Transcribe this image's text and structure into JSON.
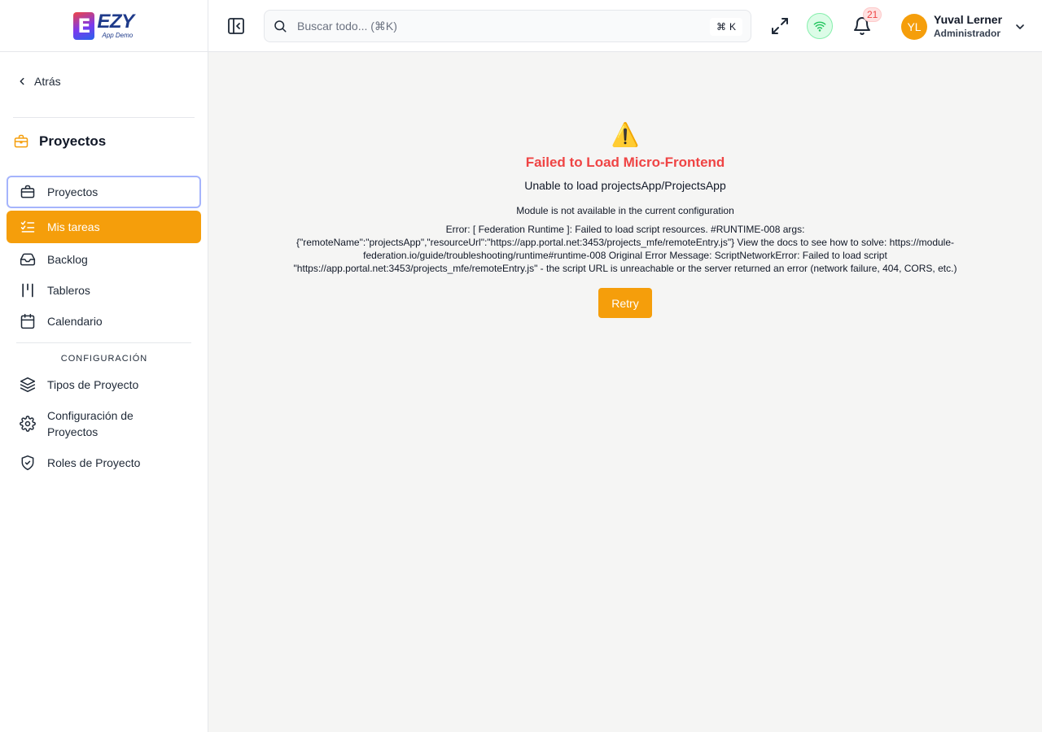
{
  "brand": {
    "logo_letter": "E",
    "name": "EZY",
    "tagline": "App Demo"
  },
  "sidebar": {
    "back_label": "Atrás",
    "section_title": "Proyectos",
    "items": [
      {
        "label": "Proyectos",
        "icon": "briefcase-icon",
        "state": "focused"
      },
      {
        "label": "Mis tareas",
        "icon": "task-list-icon",
        "state": "active"
      },
      {
        "label": "Backlog",
        "icon": "inbox-icon",
        "state": "normal"
      },
      {
        "label": "Tableros",
        "icon": "columns-icon",
        "state": "normal"
      },
      {
        "label": "Calendario",
        "icon": "calendar-icon",
        "state": "normal"
      }
    ],
    "config_label": "CONFIGURACIÓN",
    "config_items": [
      {
        "label": "Tipos de Proyecto",
        "icon": "layers-icon"
      },
      {
        "label": "Configuración de Proyectos",
        "icon": "gear-icon"
      },
      {
        "label": "Roles de Proyecto",
        "icon": "shield-check-icon"
      }
    ]
  },
  "header": {
    "search_placeholder": "Buscar todo... (⌘K)",
    "shortcut_symbol": "⌘",
    "shortcut_key": "K",
    "notification_count": "21",
    "user": {
      "initials": "YL",
      "name": "Yuval Lerner",
      "role": "Administrador"
    }
  },
  "error": {
    "icon": "⚠️",
    "title": "Failed to Load Micro-Frontend",
    "subtitle": "Unable to load projectsApp/ProjectsApp",
    "message": "Module is not available in the current configuration",
    "detail": "Error: [ Federation Runtime ]: Failed to load script resources. #RUNTIME-008 args: {\"remoteName\":\"projectsApp\",\"resourceUrl\":\"https://app.portal.net:3453/projects_mfe/remoteEntry.js\"} View the docs to see how to solve: https://module-federation.io/guide/troubleshooting/runtime#runtime-008 Original Error Message: ScriptNetworkError: Failed to load script \"https://app.portal.net:3453/projects_mfe/remoteEntry.js\" - the script URL is unreachable or the server returned an error (network failure, 404, CORS, etc.)",
    "retry_label": "Retry"
  },
  "colors": {
    "accent": "#f59e0b",
    "error": "#ef4444",
    "focus_ring": "#a5b4fc",
    "online": "#22c55e"
  }
}
